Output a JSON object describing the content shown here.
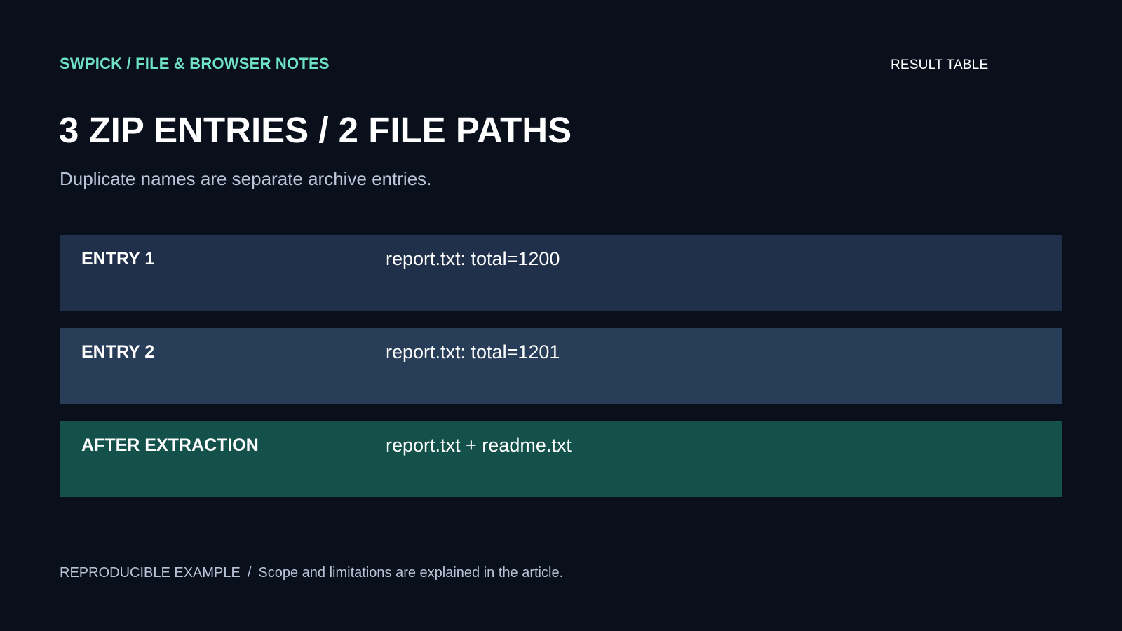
{
  "header": {
    "brand": "SWPICK / FILE & BROWSER NOTES",
    "tag": "RESULT TABLE",
    "title": "3 ZIP ENTRIES / 2 FILE PATHS",
    "subtitle": "Duplicate names are separate archive entries."
  },
  "rows": [
    {
      "label": "ENTRY 1",
      "value": "report.txt: total=1200",
      "color": "#21304a"
    },
    {
      "label": "ENTRY 2",
      "value": "report.txt: total=1201",
      "color": "#283d57"
    },
    {
      "label": "AFTER EXTRACTION",
      "value": "report.txt + readme.txt",
      "color": "#14514b"
    }
  ],
  "footer": {
    "label": "REPRODUCIBLE EXAMPLE",
    "separator": "/",
    "note": "Scope and limitations are explained in the article."
  },
  "colors": {
    "background": "#0a0f1c",
    "accent": "#6ee3c4",
    "muted_text": "#b9c4d8"
  }
}
